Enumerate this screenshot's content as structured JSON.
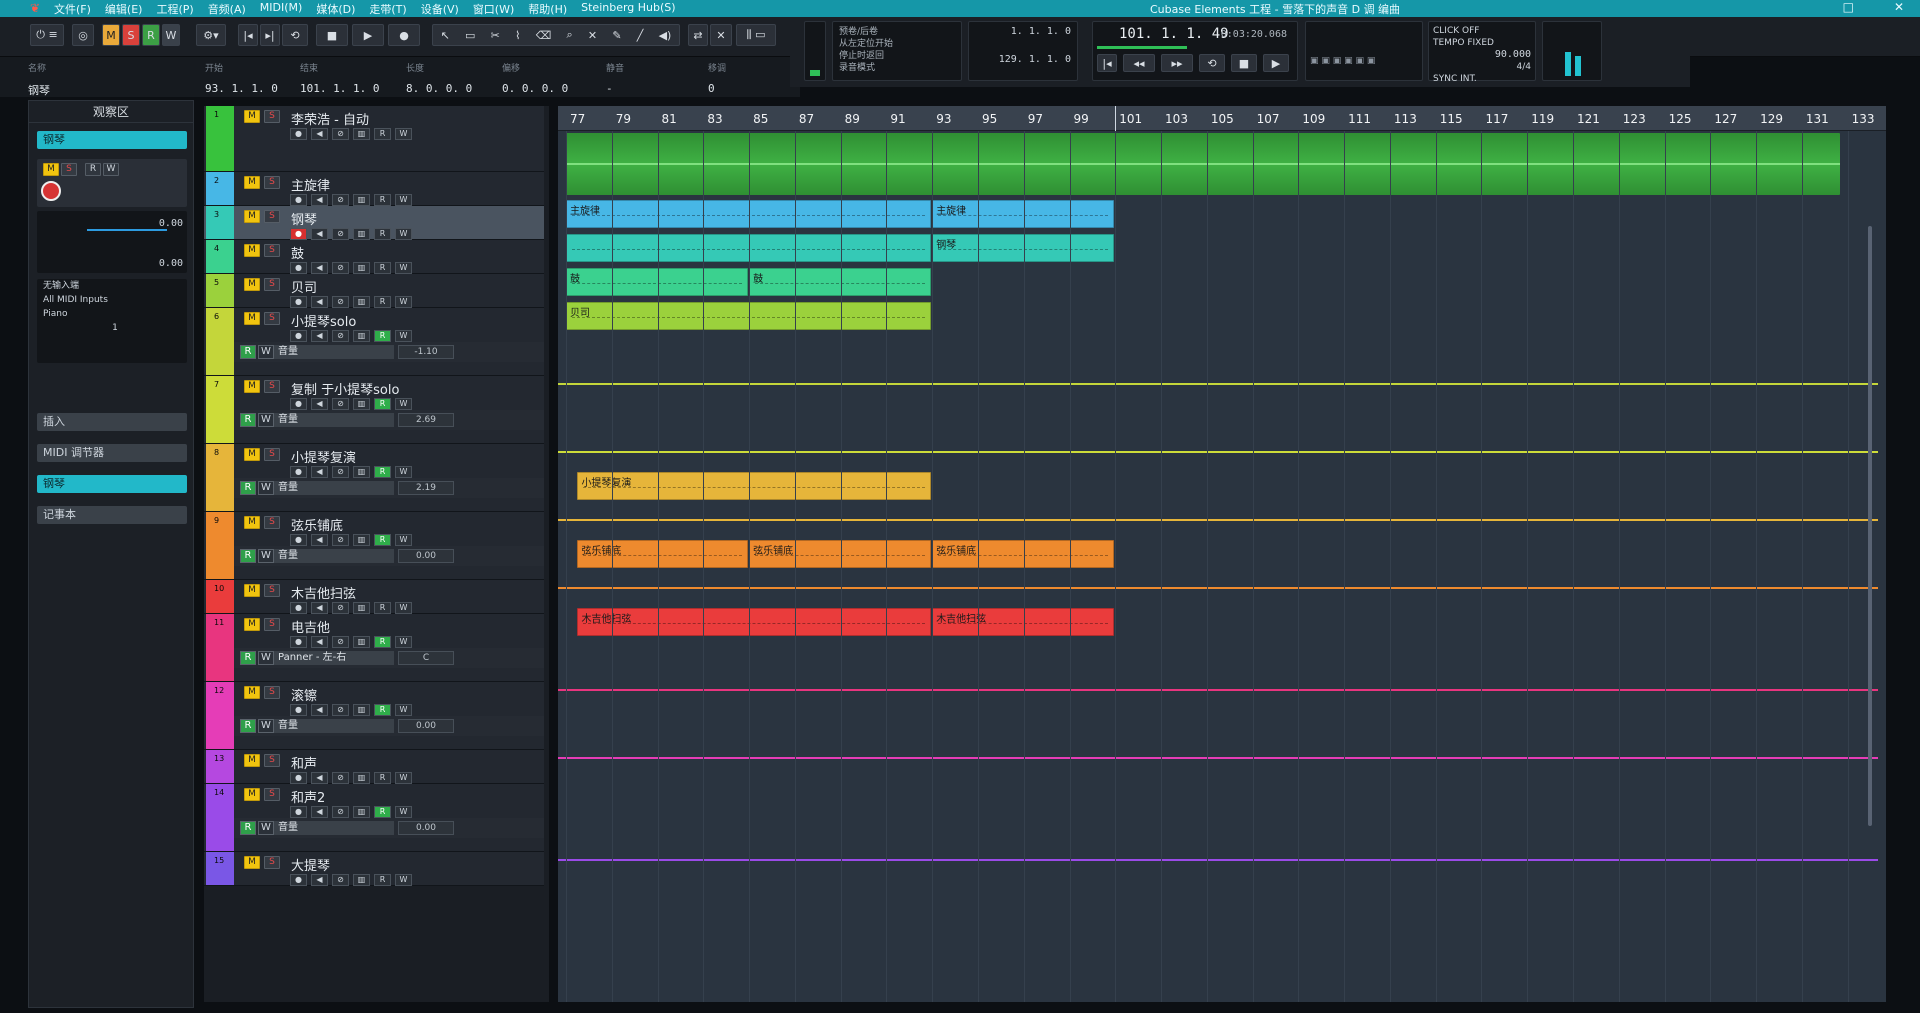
{
  "app": {
    "title": "Cubase Elements 工程 - 雪落下的声音 D 调 编曲",
    "menu": [
      "文件(F)",
      "编辑(E)",
      "工程(P)",
      "音频(A)",
      "MIDI(M)",
      "媒体(D)",
      "走带(T)",
      "设备(V)",
      "窗口(W)",
      "帮助(H)",
      "Steinberg Hub(S)"
    ],
    "window_controls": [
      "□",
      "✕"
    ]
  },
  "toolbar": {
    "mode_labels": [
      "M",
      "S",
      "R",
      "W"
    ],
    "transport_icons": [
      "|◂",
      "▸|",
      "⟲",
      "■",
      "▶",
      "●"
    ]
  },
  "infoline": {
    "headers": [
      "名称",
      "开始",
      "结束",
      "长度",
      "偏移",
      "静音",
      "锁定",
      "移调"
    ],
    "values": [
      "钢琴",
      "93. 1. 1.   0",
      "101. 1. 1.   0",
      "8. 0. 0.   0",
      "0. 0. 0.   0",
      "-",
      "",
      "0"
    ]
  },
  "transport": {
    "position": "101. 1. 1. 49",
    "time": "0:03:20.068",
    "left_locator": "1. 1. 1.   0",
    "right_locator": "129. 1. 1.   0",
    "click": "CLICK  OFF",
    "tempo_label": "TEMPO  FIXED",
    "tempo": "90.000",
    "signature": "4/4",
    "sync": "SYNC  INT.",
    "preroll_labels": [
      "预卷/后卷",
      "从左定位开始",
      "停止时返回",
      "录音模式"
    ]
  },
  "inspector": {
    "title": "观察区",
    "track_name": "钢琴",
    "volume": "0.00",
    "pan": "0.00",
    "input": "无输入端",
    "all_midi": "All MIDI Inputs",
    "output": "Piano",
    "channel": "1",
    "sections": [
      "插入",
      "MIDI 调节器",
      "钢琴",
      "记事本"
    ]
  },
  "tracks": [
    {
      "num": "1",
      "name": "李荣浩 - 自动",
      "color": "#38c23d",
      "height": 66,
      "kind": "audio"
    },
    {
      "num": "2",
      "name": "主旋律",
      "color": "#47b7e6",
      "height": 34,
      "kind": "midi"
    },
    {
      "num": "3",
      "name": "钢琴",
      "color": "#35c9b6",
      "height": 34,
      "kind": "midi",
      "selected": true
    },
    {
      "num": "4",
      "name": "鼓",
      "color": "#3bd18f",
      "height": 34,
      "kind": "midi"
    },
    {
      "num": "5",
      "name": "贝司",
      "color": "#9bd13c",
      "height": 34,
      "kind": "midi"
    },
    {
      "num": "6",
      "name": "小提琴solo",
      "color": "#c4d63a",
      "height": 34,
      "kind": "midi",
      "lane": {
        "param": "音量",
        "value": "-1.10"
      }
    },
    {
      "num": "7",
      "name": "复制 于小提琴solo",
      "color": "#cddc39",
      "height": 34,
      "kind": "midi",
      "lane": {
        "param": "音量",
        "value": "2.69"
      }
    },
    {
      "num": "8",
      "name": "小提琴复演",
      "color": "#e6b53a",
      "height": 34,
      "kind": "midi",
      "lane": {
        "param": "音量",
        "value": "2.19"
      }
    },
    {
      "num": "9",
      "name": "弦乐铺底",
      "color": "#ee8a2e",
      "height": 34,
      "kind": "midi",
      "lane": {
        "param": "音量",
        "value": "0.00"
      }
    },
    {
      "num": "10",
      "name": "木吉他扫弦",
      "color": "#ea3c3c",
      "height": 34,
      "kind": "midi"
    },
    {
      "num": "11",
      "name": "电吉他",
      "color": "#e8357f",
      "height": 34,
      "kind": "midi",
      "lane": {
        "param": "Panner - 左-右",
        "value": "C"
      }
    },
    {
      "num": "12",
      "name": "滚镲",
      "color": "#e53db7",
      "height": 34,
      "kind": "midi",
      "lane": {
        "param": "音量",
        "value": "0.00"
      }
    },
    {
      "num": "13",
      "name": "和声",
      "color": "#b548e0",
      "height": 34,
      "kind": "midi"
    },
    {
      "num": "14",
      "name": "和声2",
      "color": "#9a4be8",
      "height": 34,
      "kind": "midi",
      "lane": {
        "param": "音量",
        "value": "0.00"
      }
    },
    {
      "num": "15",
      "name": "大提琴",
      "color": "#7a57e6",
      "height": 34,
      "kind": "midi"
    }
  ],
  "ruler": [
    "77",
    "79",
    "81",
    "83",
    "85",
    "87",
    "89",
    "91",
    "93",
    "95",
    "97",
    "99",
    "101",
    "103",
    "105",
    "107",
    "109",
    "111",
    "113",
    "115",
    "117",
    "119",
    "121",
    "123",
    "125",
    "127",
    "129",
    "131",
    "133"
  ],
  "parts": [
    {
      "track": "2",
      "label": "主旋律",
      "from": 77,
      "to": 93
    },
    {
      "track": "2",
      "label": "主旋律",
      "from": 93,
      "to": 101
    },
    {
      "track": "3",
      "label": "",
      "from": 77,
      "to": 93
    },
    {
      "track": "3",
      "label": "钢琴",
      "from": 93,
      "to": 101
    },
    {
      "track": "4",
      "label": "鼓",
      "from": 77,
      "to": 85
    },
    {
      "track": "4",
      "label": "鼓",
      "from": 85,
      "to": 93
    },
    {
      "track": "5",
      "label": "贝司",
      "from": 77,
      "to": 93
    },
    {
      "track": "8",
      "label": "小提琴复演",
      "from": 77.5,
      "to": 93
    },
    {
      "track": "9",
      "label": "弦乐铺底",
      "from": 77.5,
      "to": 85
    },
    {
      "track": "9",
      "label": "弦乐铺底",
      "from": 85,
      "to": 93
    },
    {
      "track": "9",
      "label": "弦乐铺底",
      "from": 93,
      "to": 101
    },
    {
      "track": "10",
      "label": "木吉他扫弦",
      "from": 77.5,
      "to": 93
    },
    {
      "track": "10",
      "label": "木吉他扫弦",
      "from": 93,
      "to": 101
    }
  ],
  "audio_part": {
    "track": "1",
    "from": 77,
    "to": 133
  },
  "playhead_bar": 101
}
